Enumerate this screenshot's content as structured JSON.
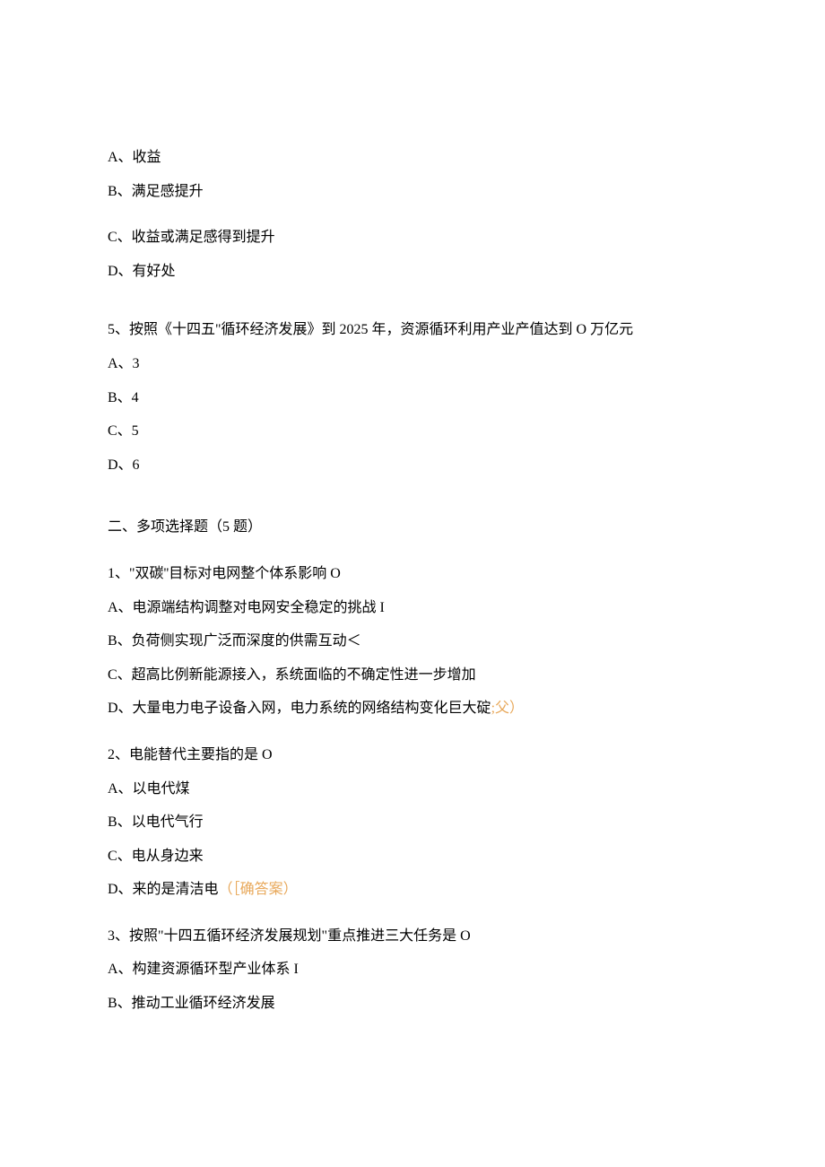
{
  "q4": {
    "optA": "A、收益",
    "optB": "B、满足感提升",
    "optC": "C、收益或满足感得到提升",
    "optD": "D、有好处"
  },
  "q5": {
    "stem": "5、按照《十四五\"循环经济发展》到 2025 年，资源循环利用产业产值达到 O 万亿元",
    "optA": "A、3",
    "optB": "B、4",
    "optC": "C、5",
    "optD": "D、6"
  },
  "section2": {
    "title": "二、多项选择题（5 题）"
  },
  "m1": {
    "stem": "1、\"双碳''目标对电网整个体系影响 O",
    "optA": "A、电源端结构调整对电网安全稳定的挑战 I",
    "optB": "B、负荷侧实现广泛而深度的供需互动＜",
    "optC": "C、超高比例新能源接入，系统面临的不确定性进一步增加",
    "optD_text": "D、大量电力电子设备入网，电力系统的网络结构变化巨大碇",
    "optD_mark": ";父）"
  },
  "m2": {
    "stem": "2、电能替代主要指的是 O",
    "optA": "A、以电代煤",
    "optB": "B、以电代气行",
    "optC": "C、电从身边来",
    "optD_text": "D、来的是清洁电",
    "optD_mark": "（［确答案）"
  },
  "m3": {
    "stem": "3、按照\"十四五循环经济发展规划\"重点推进三大任务是 O",
    "optA": "A、构建资源循环型产业体系 I",
    "optB": "B、推动工业循环经济发展"
  }
}
